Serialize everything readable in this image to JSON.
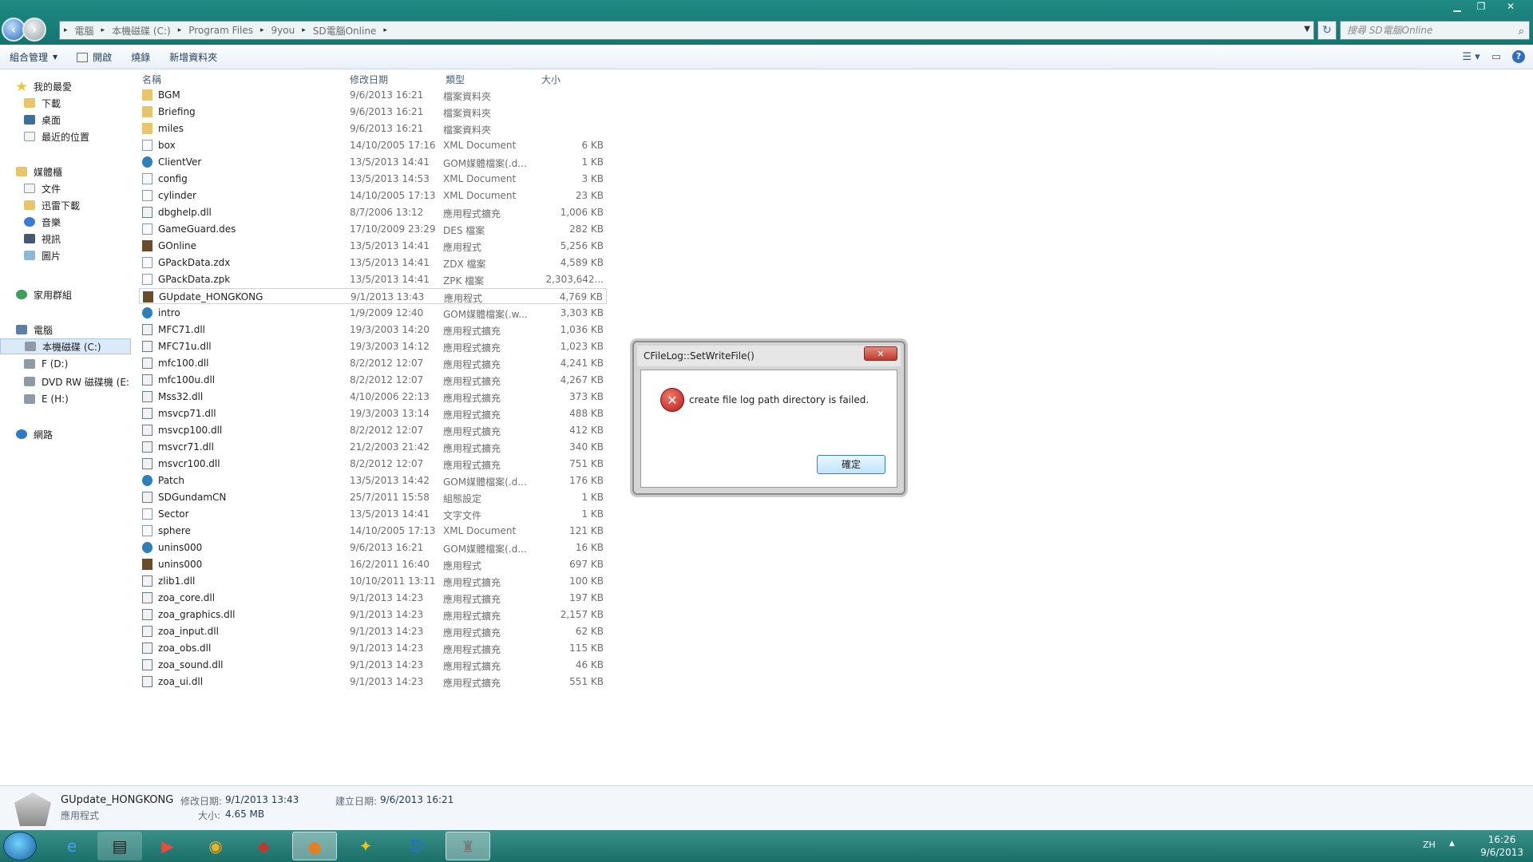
{
  "window": {
    "controls": [
      "▁",
      "❐",
      "✕"
    ]
  },
  "nav": {
    "back_icon": "back-arrow-icon",
    "forward_icon": "forward-arrow-icon"
  },
  "address": {
    "crumbs": [
      "電腦",
      "本機磁碟 (C:)",
      "Program Files",
      "9you",
      "SD電腦Online"
    ]
  },
  "search": {
    "placeholder": "搜尋 SD電腦Online"
  },
  "toolbar": {
    "organize": "組合管理",
    "open": "開啟",
    "burn": "燒錄",
    "new_folder": "新增資料夾"
  },
  "sidebar": {
    "favorites": "我的最愛",
    "downloads": "下載",
    "desktop": "桌面",
    "recent": "最近的位置",
    "libraries": "媒體櫃",
    "documents": "文件",
    "xunlei": "迅雷下載",
    "music": "音樂",
    "videos": "視訊",
    "pictures": "圖片",
    "homegroup": "家用群組",
    "computer": "電腦",
    "drive_c": "本機磁碟 (C:)",
    "drive_f": "F (D:)",
    "drive_dvd": "DVD RW 磁碟機 (E:",
    "drive_e": "E (H:)",
    "network": "網路"
  },
  "columns": {
    "name": "名稱",
    "date": "修改日期",
    "type": "類型",
    "size": "大小"
  },
  "files": [
    {
      "name": "BGM",
      "date": "9/6/2013 16:21",
      "type": "檔案資料夾",
      "size": "",
      "kind": "folder"
    },
    {
      "name": "Briefing",
      "date": "9/6/2013 16:21",
      "type": "檔案資料夾",
      "size": "",
      "kind": "folder"
    },
    {
      "name": "miles",
      "date": "9/6/2013 16:21",
      "type": "檔案資料夾",
      "size": "",
      "kind": "folder"
    },
    {
      "name": "box",
      "date": "14/10/2005 17:16",
      "type": "XML Document",
      "size": "6 KB",
      "kind": "file"
    },
    {
      "name": "ClientVer",
      "date": "13/5/2013 14:41",
      "type": "GOM媒體檔案(.d...",
      "size": "1 KB",
      "kind": "gom"
    },
    {
      "name": "config",
      "date": "13/5/2013 14:53",
      "type": "XML Document",
      "size": "3 KB",
      "kind": "file"
    },
    {
      "name": "cylinder",
      "date": "14/10/2005 17:13",
      "type": "XML Document",
      "size": "23 KB",
      "kind": "file"
    },
    {
      "name": "dbghelp.dll",
      "date": "8/7/2006 13:12",
      "type": "應用程式擴充",
      "size": "1,006 KB",
      "kind": "dll"
    },
    {
      "name": "GameGuard.des",
      "date": "17/10/2009 23:29",
      "type": "DES 檔案",
      "size": "282 KB",
      "kind": "file"
    },
    {
      "name": "GOnline",
      "date": "13/5/2013 14:41",
      "type": "應用程式",
      "size": "5,256 KB",
      "kind": "exe"
    },
    {
      "name": "GPackData.zdx",
      "date": "13/5/2013 14:41",
      "type": "ZDX 檔案",
      "size": "4,589 KB",
      "kind": "file"
    },
    {
      "name": "GPackData.zpk",
      "date": "13/5/2013 14:41",
      "type": "ZPK 檔案",
      "size": "2,303,642...",
      "kind": "file"
    },
    {
      "name": "GUpdate_HONGKONG",
      "date": "9/1/2013 13:43",
      "type": "應用程式",
      "size": "4,769 KB",
      "kind": "exe"
    },
    {
      "name": "intro",
      "date": "1/9/2009 12:40",
      "type": "GOM媒體檔案(.w...",
      "size": "3,303 KB",
      "kind": "gom"
    },
    {
      "name": "MFC71.dll",
      "date": "19/3/2003 14:20",
      "type": "應用程式擴充",
      "size": "1,036 KB",
      "kind": "dll"
    },
    {
      "name": "MFC71u.dll",
      "date": "19/3/2003 14:12",
      "type": "應用程式擴充",
      "size": "1,023 KB",
      "kind": "dll"
    },
    {
      "name": "mfc100.dll",
      "date": "8/2/2012 12:07",
      "type": "應用程式擴充",
      "size": "4,241 KB",
      "kind": "dll"
    },
    {
      "name": "mfc100u.dll",
      "date": "8/2/2012 12:07",
      "type": "應用程式擴充",
      "size": "4,267 KB",
      "kind": "dll"
    },
    {
      "name": "Mss32.dll",
      "date": "4/10/2006 22:13",
      "type": "應用程式擴充",
      "size": "373 KB",
      "kind": "dll"
    },
    {
      "name": "msvcp71.dll",
      "date": "19/3/2003 13:14",
      "type": "應用程式擴充",
      "size": "488 KB",
      "kind": "dll"
    },
    {
      "name": "msvcp100.dll",
      "date": "8/2/2012 12:07",
      "type": "應用程式擴充",
      "size": "412 KB",
      "kind": "dll"
    },
    {
      "name": "msvcr71.dll",
      "date": "21/2/2003 21:42",
      "type": "應用程式擴充",
      "size": "340 KB",
      "kind": "dll"
    },
    {
      "name": "msvcr100.dll",
      "date": "8/2/2012 12:07",
      "type": "應用程式擴充",
      "size": "751 KB",
      "kind": "dll"
    },
    {
      "name": "Patch",
      "date": "13/5/2013 14:42",
      "type": "GOM媒體檔案(.d...",
      "size": "176 KB",
      "kind": "gom"
    },
    {
      "name": "SDGundamCN",
      "date": "25/7/2011 15:58",
      "type": "組態設定",
      "size": "1 KB",
      "kind": "dll"
    },
    {
      "name": "Sector",
      "date": "13/5/2013 14:41",
      "type": "文字文件",
      "size": "1 KB",
      "kind": "file"
    },
    {
      "name": "sphere",
      "date": "14/10/2005 17:13",
      "type": "XML Document",
      "size": "121 KB",
      "kind": "file"
    },
    {
      "name": "unins000",
      "date": "9/6/2013 16:21",
      "type": "GOM媒體檔案(.d...",
      "size": "16 KB",
      "kind": "gom"
    },
    {
      "name": "unins000",
      "date": "16/2/2011 16:40",
      "type": "應用程式",
      "size": "697 KB",
      "kind": "exe"
    },
    {
      "name": "zlib1.dll",
      "date": "10/10/2011 13:11",
      "type": "應用程式擴充",
      "size": "100 KB",
      "kind": "dll"
    },
    {
      "name": "zoa_core.dll",
      "date": "9/1/2013 14:23",
      "type": "應用程式擴充",
      "size": "197 KB",
      "kind": "dll"
    },
    {
      "name": "zoa_graphics.dll",
      "date": "9/1/2013 14:23",
      "type": "應用程式擴充",
      "size": "2,157 KB",
      "kind": "dll"
    },
    {
      "name": "zoa_input.dll",
      "date": "9/1/2013 14:23",
      "type": "應用程式擴充",
      "size": "62 KB",
      "kind": "dll"
    },
    {
      "name": "zoa_obs.dll",
      "date": "9/1/2013 14:23",
      "type": "應用程式擴充",
      "size": "115 KB",
      "kind": "dll"
    },
    {
      "name": "zoa_sound.dll",
      "date": "9/1/2013 14:23",
      "type": "應用程式擴充",
      "size": "46 KB",
      "kind": "dll"
    },
    {
      "name": "zoa_ui.dll",
      "date": "9/1/2013 14:23",
      "type": "應用程式擴充",
      "size": "551 KB",
      "kind": "dll"
    }
  ],
  "selected_file": "GUpdate_HONGKONG",
  "dialog": {
    "title": "CFileLog::SetWriteFile()",
    "message": "create file log path directory is failed.",
    "ok": "確定",
    "close_glyph": "✕"
  },
  "details": {
    "name": "GUpdate_HONGKONG",
    "kind": "應用程式",
    "modified_label": "修改日期:",
    "modified_value": "9/1/2013 13:43",
    "created_label": "建立日期:",
    "created_value": "9/6/2013 16:21",
    "size_label": "大小:",
    "size_value": "4.65 MB"
  },
  "taskbar": {
    "lang": "ZH",
    "time": "16:26",
    "date": "9/6/2013"
  },
  "colors": {
    "accent": "#13756f",
    "selection": "#dbe9f9",
    "error": "#b71c1c"
  }
}
